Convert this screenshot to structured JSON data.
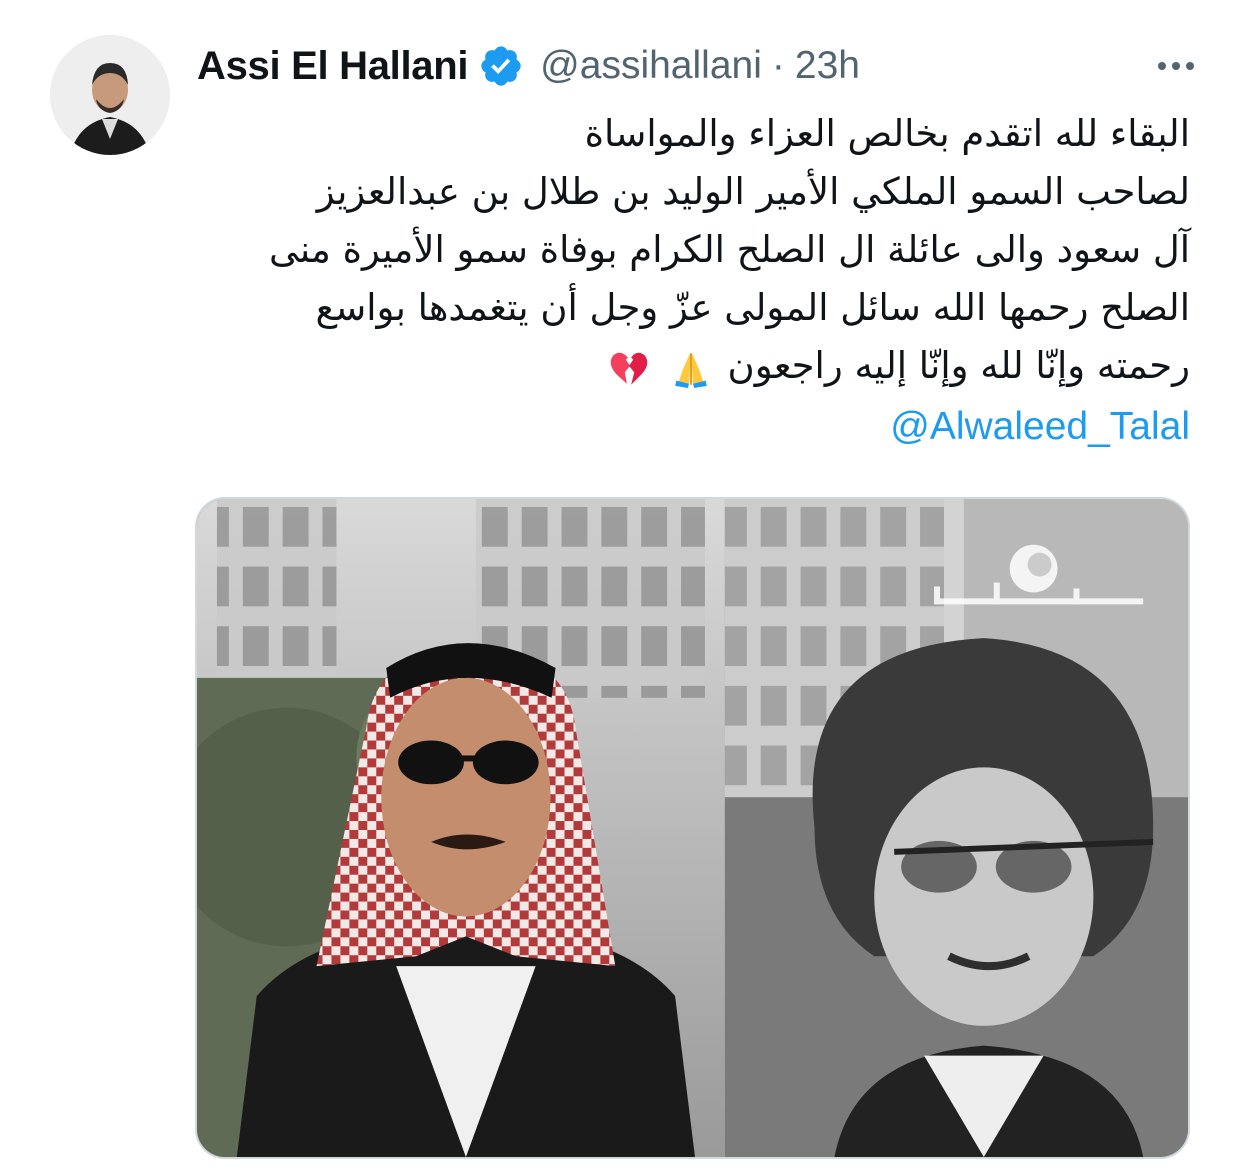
{
  "tweet": {
    "author": {
      "display_name": "Assi El Hallani",
      "handle": "@assihallani",
      "verified": true,
      "avatar_icon": "profile-photo"
    },
    "separator": "·",
    "timestamp": "23h",
    "more_icon": "more-horizontal-icon",
    "text_lines": [
      "البقاء لله اتقدم بخالص العزاء والمواساة",
      "لصاحب السمو الملكي الأمير الوليد بن طلال بن عبدالعزيز",
      "آل سعود والى عائلة ال الصلح  الكرام بوفاة سمو الأميرة منى",
      "الصلح رحمها الله سائل المولى عزّ وجل أن يتغمدها بواسع",
      "رحمته وإنّا لله وإنّا إليه راجعون"
    ],
    "emojis": [
      "folded-hands-emoji",
      "broken-heart-emoji"
    ],
    "mention": "@Alwaleed_Talal",
    "media": {
      "type": "photo",
      "watermark": "rotana-logo"
    }
  },
  "colors": {
    "text": "#0f1419",
    "secondary": "#536471",
    "link": "#1d9bf0",
    "verified": "#1d9bf0",
    "border": "#cfd9de"
  }
}
